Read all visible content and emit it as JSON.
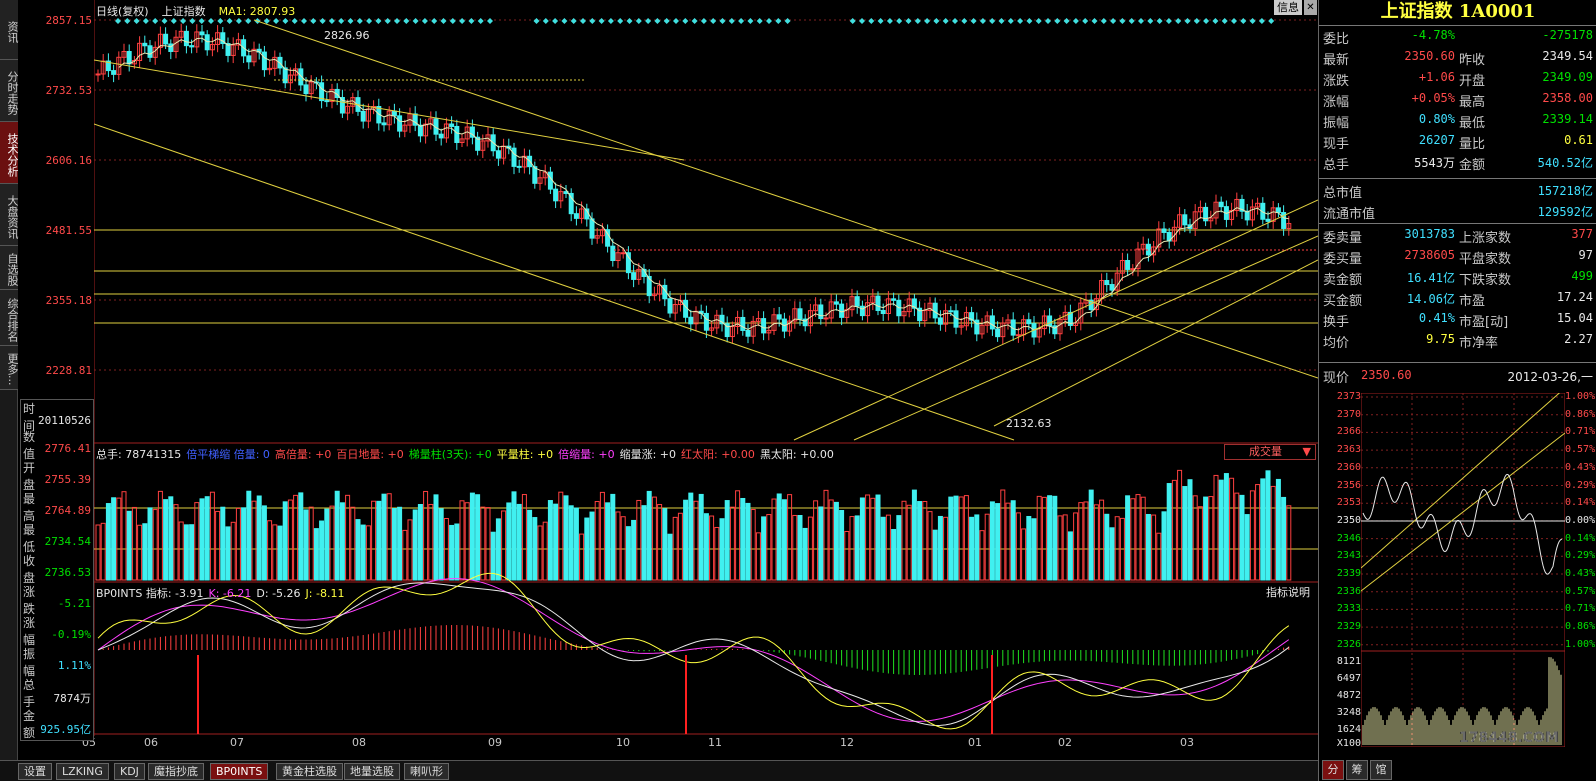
{
  "left_tabs": [
    {
      "label": "资讯",
      "active": false
    },
    {
      "label": "分时走势",
      "active": false
    },
    {
      "label": "技术分析",
      "active": true
    },
    {
      "label": "大盘资讯",
      "active": false
    },
    {
      "label": "自选股",
      "active": false
    },
    {
      "label": "综合排名",
      "active": false
    },
    {
      "label": "更多...",
      "active": false
    }
  ],
  "header": {
    "period": "日线(复权)",
    "symbol": "上证指数",
    "ma_label": "MA1: 2807.93",
    "info_button": "信息"
  },
  "price_axis": [
    "2857.15",
    "2732.53",
    "2606.16",
    "2481.55",
    "2355.18",
    "2228.81"
  ],
  "annotations": {
    "high": "2826.96",
    "low": "2132.63"
  },
  "data_window": {
    "time_label": "时间",
    "time_value": "20110526",
    "rows": [
      {
        "label": "数值",
        "value": "2776.41",
        "color": "#ff4a4a"
      },
      {
        "label": "开盘",
        "value": "2755.39",
        "color": "#ff4a4a"
      },
      {
        "label": "最高",
        "value": "2764.89",
        "color": "#ff4a4a"
      },
      {
        "label": "最低",
        "value": "2734.54",
        "color": "#00e000"
      },
      {
        "label": "收盘",
        "value": "2736.53",
        "color": "#00e000"
      },
      {
        "label": "涨跌",
        "value": "-5.21",
        "color": "#00e000"
      },
      {
        "label": "涨幅",
        "value": "-0.19%",
        "color": "#00e000"
      },
      {
        "label": "振幅",
        "value": "1.11%",
        "color": "#40e0ff"
      },
      {
        "label": "总手",
        "value": "7874万",
        "color": "#e8e8e8"
      },
      {
        "label": "金额",
        "value": "925.95亿",
        "color": "#40e0ff"
      }
    ]
  },
  "volume_header": {
    "parts": [
      {
        "text": "总手: 78741315",
        "color": "#e8e8e8"
      },
      {
        "text": "倍平梯缩 倍量: 0",
        "color": "#4060ff"
      },
      {
        "text": "高倍量: +0",
        "color": "#ff4a4a"
      },
      {
        "text": "百日地量: +0",
        "color": "#ff4a4a"
      },
      {
        "text": "梯量柱(3天): +0",
        "color": "#00e000"
      },
      {
        "text": "平量柱: +0",
        "color": "#ffff40"
      },
      {
        "text": "倍缩量: +0",
        "color": "#ff40ff"
      },
      {
        "text": "缩量涨: +0",
        "color": "#e8e8e8"
      },
      {
        "text": "红太阳: +0.00",
        "color": "#ff4a4a"
      },
      {
        "text": "黑太阳: +0.00",
        "color": "#e8e8e8"
      }
    ],
    "dropdown": "成交量"
  },
  "indicator_header": {
    "parts": [
      {
        "text": "BP0INTS 指标: -3.91",
        "color": "#e8e8e8"
      },
      {
        "text": "K: -6.21",
        "color": "#ff40ff"
      },
      {
        "text": "D: -5.26",
        "color": "#e8e8e8"
      },
      {
        "text": "J: -8.11",
        "color": "#ffff40"
      }
    ],
    "help": "指标说明"
  },
  "months": [
    "05",
    "06",
    "07",
    "08",
    "09",
    "10",
    "11",
    "12",
    "01",
    "02",
    "03"
  ],
  "bottom_tabs": [
    {
      "label": "设置",
      "active": false
    },
    {
      "label": "LZKING",
      "active": false
    },
    {
      "label": "KDJ",
      "active": false
    },
    {
      "label": "魔指抄底",
      "active": false
    },
    {
      "label": "BP0INTS",
      "active": true
    },
    {
      "label": "黄金柱选股",
      "active": false
    },
    {
      "label": "地量选股",
      "active": false
    },
    {
      "label": "喇叭形",
      "active": false
    }
  ],
  "quote": {
    "title": "上证指数 1A0001",
    "rows": [
      {
        "l": "委比",
        "v": "-4.78%",
        "vc": "green",
        "l2": "",
        "v2": "-275178",
        "v2c": "green"
      },
      {
        "l": "最新",
        "v": "2350.60",
        "vc": "red",
        "l2": "昨收",
        "v2": "2349.54",
        "v2c": "white"
      },
      {
        "l": "涨跌",
        "v": "+1.06",
        "vc": "red",
        "l2": "开盘",
        "v2": "2349.09",
        "v2c": "green"
      },
      {
        "l": "涨幅",
        "v": "+0.05%",
        "vc": "red",
        "l2": "最高",
        "v2": "2358.00",
        "v2c": "red"
      },
      {
        "l": "振幅",
        "v": "0.80%",
        "vc": "cyan",
        "l2": "最低",
        "v2": "2339.14",
        "v2c": "green"
      },
      {
        "l": "现手",
        "v": "26207",
        "vc": "cyan",
        "l2": "量比",
        "v2": "0.61",
        "v2c": "yellow"
      },
      {
        "l": "总手",
        "v": "5543万",
        "vc": "white",
        "l2": "金额",
        "v2": "540.52亿",
        "v2c": "cyan"
      }
    ],
    "mcap": [
      {
        "l": "总市值",
        "v": "157218亿"
      },
      {
        "l": "流通市值",
        "v": "129592亿"
      }
    ],
    "rows2": [
      {
        "l": "委卖量",
        "v": "3013783",
        "vc": "cyan",
        "l2": "上涨家数",
        "v2": "377",
        "v2c": "red"
      },
      {
        "l": "委买量",
        "v": "2738605",
        "vc": "red",
        "l2": "平盘家数",
        "v2": "97",
        "v2c": "white"
      },
      {
        "l": "卖金额",
        "v": "16.41亿",
        "vc": "cyan",
        "l2": "下跌家数",
        "v2": "499",
        "v2c": "green"
      },
      {
        "l": "买金额",
        "v": "14.06亿",
        "vc": "cyan",
        "l2": "市盈",
        "v2": "17.24",
        "v2c": "white"
      },
      {
        "l": "换手",
        "v": "0.41%",
        "vc": "cyan",
        "l2": "市盈[动]",
        "v2": "15.04",
        "v2c": "white"
      },
      {
        "l": "均价",
        "v": "9.75",
        "vc": "yellow",
        "l2": "市净率",
        "v2": "2.27",
        "v2c": "white"
      }
    ],
    "current_label": "现价",
    "current_value": "2350.60",
    "date": "2012-03-26,一"
  },
  "minichart": {
    "left_axis": [
      {
        "v": "2373",
        "c": "#ff4a4a"
      },
      {
        "v": "2370",
        "c": "#ff4a4a"
      },
      {
        "v": "2366",
        "c": "#ff4a4a"
      },
      {
        "v": "2363",
        "c": "#ff4a4a"
      },
      {
        "v": "2360",
        "c": "#ff4a4a"
      },
      {
        "v": "2356",
        "c": "#ff4a4a"
      },
      {
        "v": "2353",
        "c": "#ff4a4a"
      },
      {
        "v": "2350",
        "c": "#e8e8e8"
      },
      {
        "v": "2346",
        "c": "#00e000"
      },
      {
        "v": "2343",
        "c": "#00e000"
      },
      {
        "v": "2339",
        "c": "#00e000"
      },
      {
        "v": "2336",
        "c": "#00e000"
      },
      {
        "v": "2333",
        "c": "#00e000"
      },
      {
        "v": "2329",
        "c": "#00e000"
      },
      {
        "v": "2326",
        "c": "#00e000"
      }
    ],
    "right_axis": [
      {
        "v": "1.00%",
        "c": "#ff4a4a"
      },
      {
        "v": "0.86%",
        "c": "#ff4a4a"
      },
      {
        "v": "0.71%",
        "c": "#ff4a4a"
      },
      {
        "v": "0.57%",
        "c": "#ff4a4a"
      },
      {
        "v": "0.43%",
        "c": "#ff4a4a"
      },
      {
        "v": "0.29%",
        "c": "#ff4a4a"
      },
      {
        "v": "0.14%",
        "c": "#ff4a4a"
      },
      {
        "v": "0.00%",
        "c": "#e8e8e8"
      },
      {
        "v": "0.14%",
        "c": "#00e000"
      },
      {
        "v": "0.29%",
        "c": "#00e000"
      },
      {
        "v": "0.43%",
        "c": "#00e000"
      },
      {
        "v": "0.57%",
        "c": "#00e000"
      },
      {
        "v": "0.71%",
        "c": "#00e000"
      },
      {
        "v": "0.86%",
        "c": "#00e000"
      },
      {
        "v": "1.00%",
        "c": "#00e000"
      }
    ],
    "vol_axis": [
      "8121",
      "6497",
      "4872",
      "3248",
      "1624"
    ],
    "vol_unit": "X100",
    "watermark": "178448.COM"
  },
  "right_bottom_tabs": [
    {
      "label": "分",
      "active": true
    },
    {
      "label": "筹",
      "active": false
    },
    {
      "label": "馆",
      "active": false
    }
  ]
}
